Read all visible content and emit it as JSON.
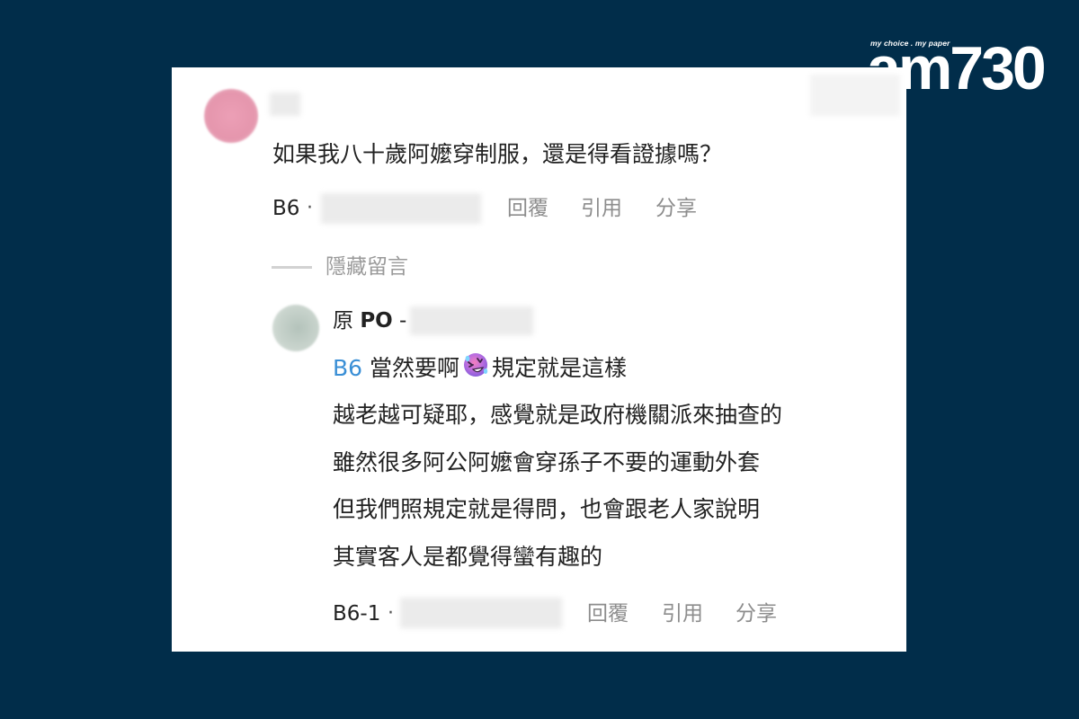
{
  "brand": {
    "tagline": "my choice . my paper",
    "logo": "am730"
  },
  "comment": {
    "text": "如果我八十歲阿嬤穿制服，還是得看證據嗎？",
    "floor": "B6",
    "actions": [
      "回覆",
      "引用",
      "分享"
    ]
  },
  "hidden_toggle": "隱藏留言",
  "reply": {
    "author_prefix": "原",
    "author_tag": "PO",
    "author_sep": "-",
    "quote_ref": "B6",
    "line1_before": "當然要啊",
    "emoji_name": "rolling-on-floor-laughing-emoji",
    "line1_after": "規定就是這樣",
    "lines": [
      "越老越可疑耶，感覺就是政府機關派來抽查的",
      "雖然很多阿公阿嬤會穿孫子不要的運動外套",
      "但我們照規定就是得問，也會跟老人家說明",
      "其實客人是都覺得蠻有趣的"
    ],
    "floor": "B6-1",
    "actions": [
      "回覆",
      "引用",
      "分享"
    ]
  },
  "colors": {
    "background": "#012d4a",
    "card": "#ffffff",
    "link": "#3a8fd6",
    "muted": "#8d8d8d"
  }
}
